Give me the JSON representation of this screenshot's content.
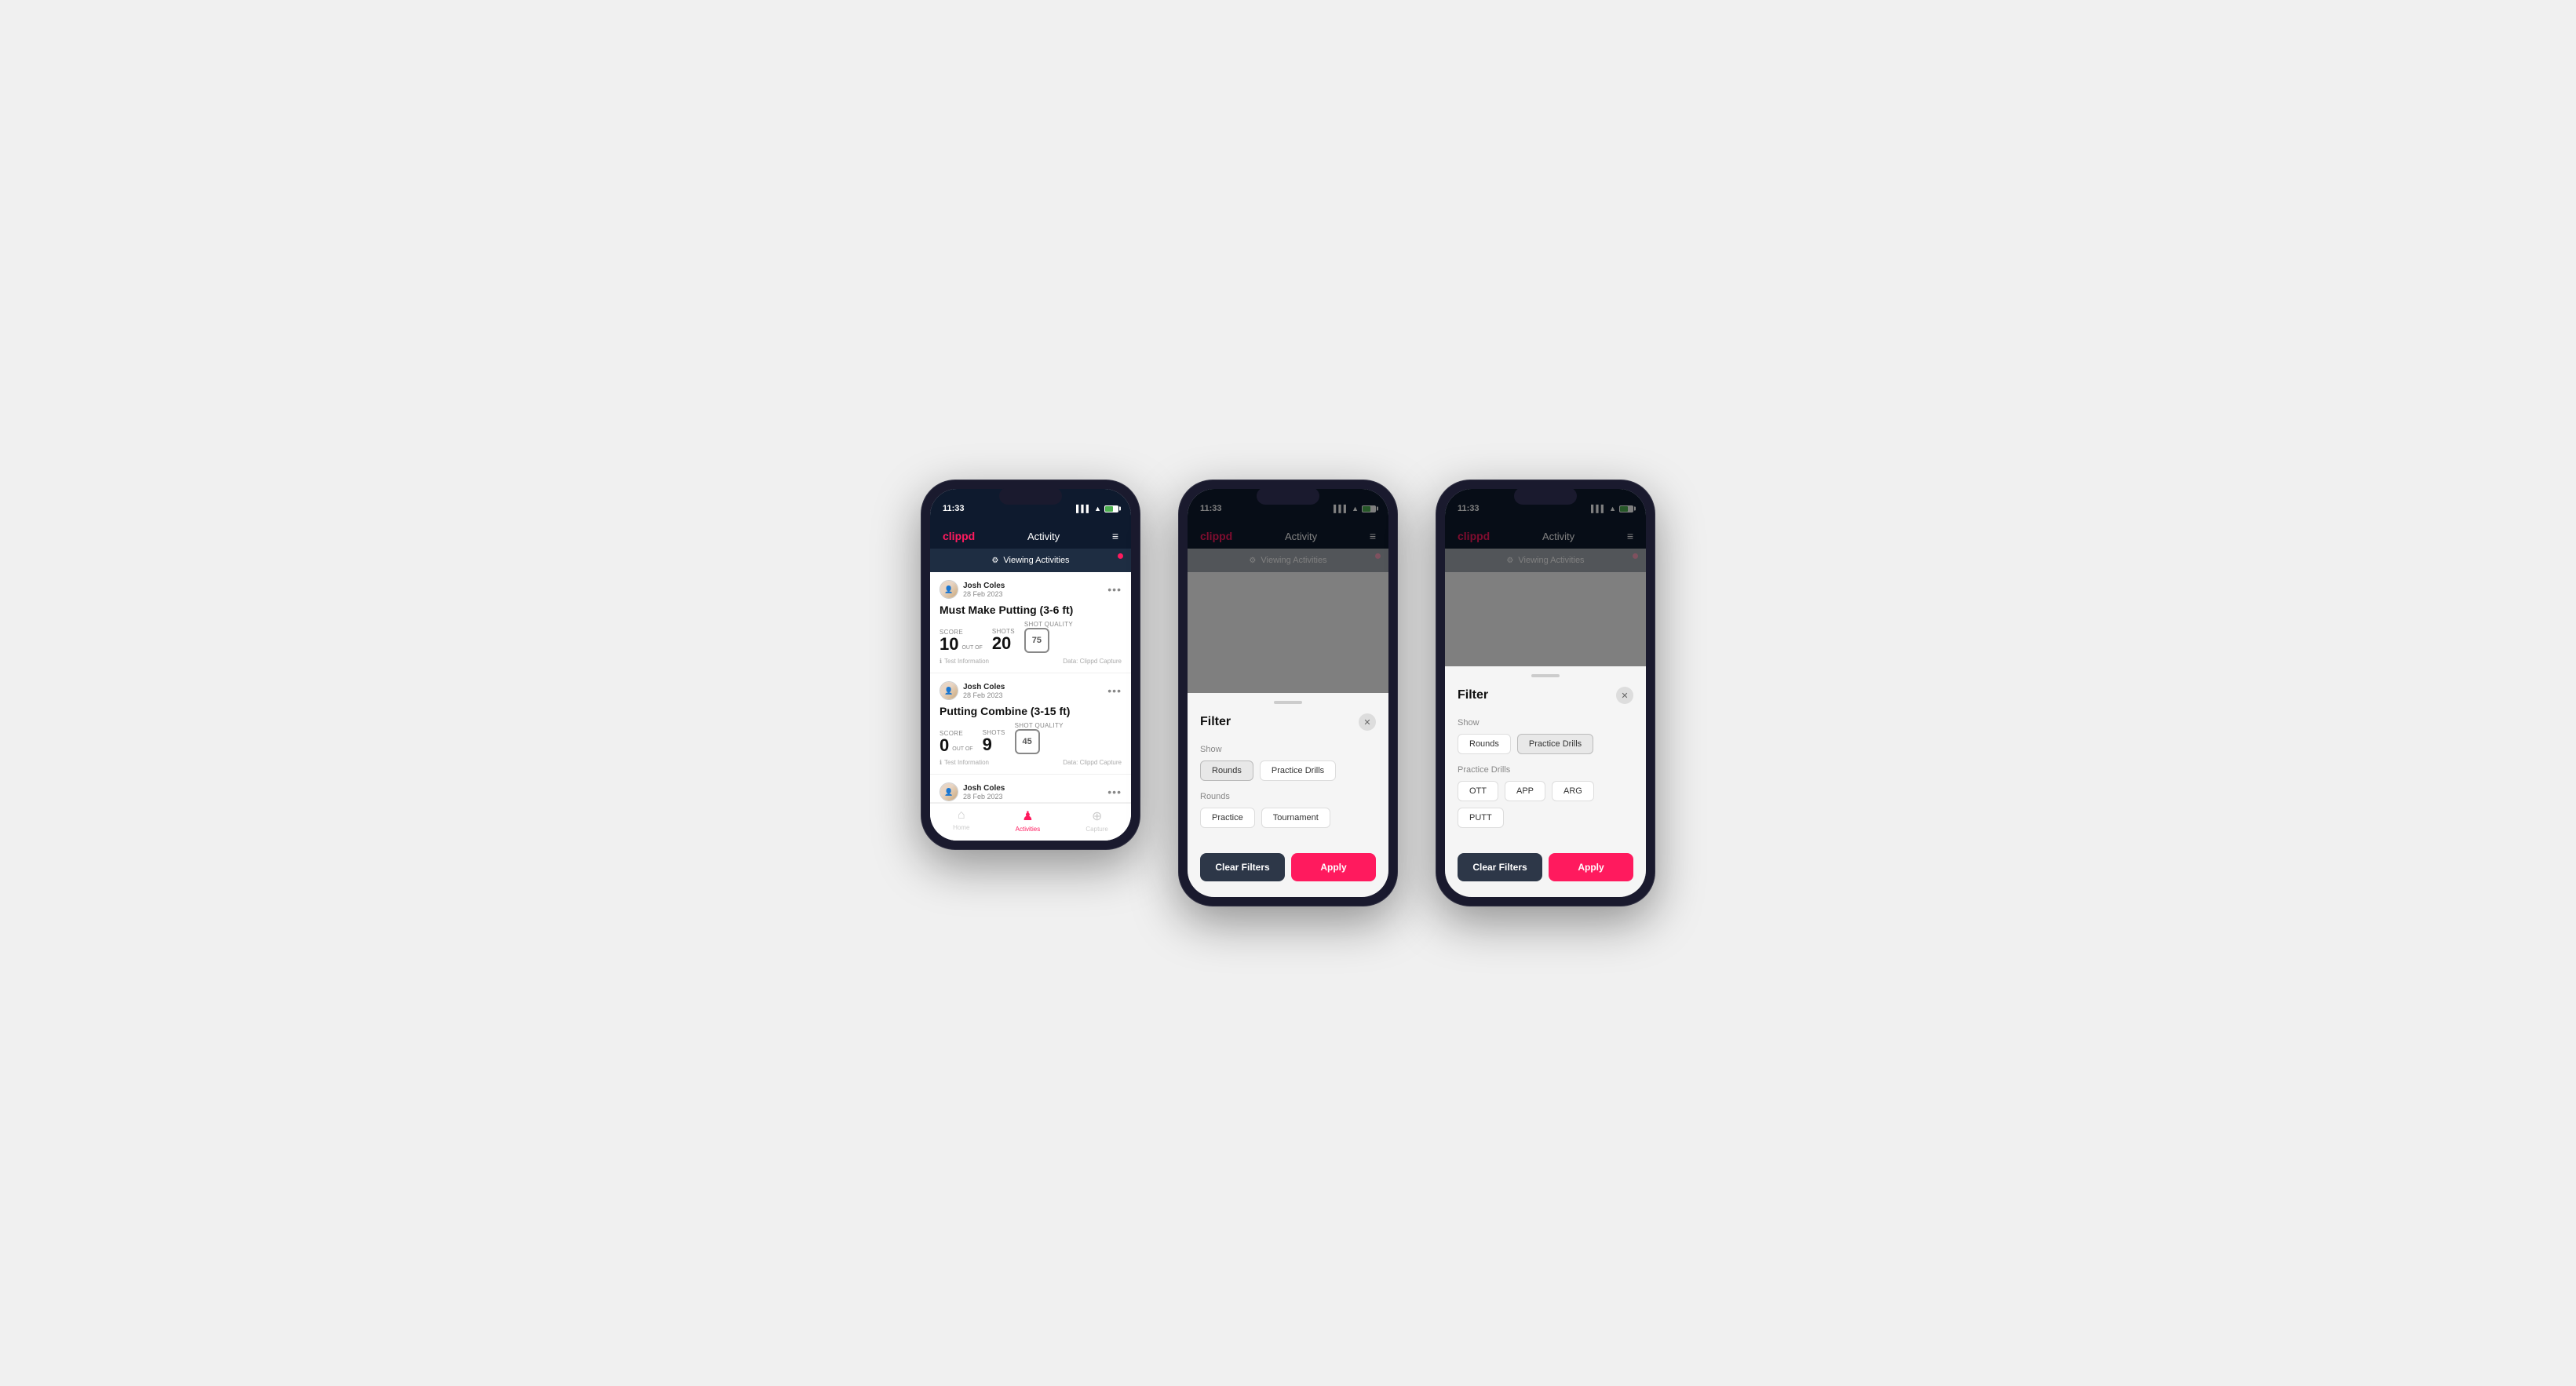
{
  "phones": [
    {
      "id": "phone1",
      "statusBar": {
        "time": "11:33",
        "batteryLevel": 60
      },
      "header": {
        "logo": "clippd",
        "title": "Activity"
      },
      "banner": {
        "text": "Viewing Activities",
        "hasDot": true
      },
      "cards": [
        {
          "user": "Josh Coles",
          "date": "28 Feb 2023",
          "title": "Must Make Putting (3-6 ft)",
          "scoreLabel": "Score",
          "scoreValue": "10",
          "outOf": "OUT OF",
          "shotsLabel": "Shots",
          "shotsValue": "20",
          "sqLabel": "Shot Quality",
          "sqValue": "75",
          "infoText": "Test Information",
          "dataSource": "Data: Clippd Capture"
        },
        {
          "user": "Josh Coles",
          "date": "28 Feb 2023",
          "title": "Putting Combine (3-15 ft)",
          "scoreLabel": "Score",
          "scoreValue": "0",
          "outOf": "OUT OF",
          "shotsLabel": "Shots",
          "shotsValue": "9",
          "sqLabel": "Shot Quality",
          "sqValue": "45",
          "infoText": "Test Information",
          "dataSource": "Data: Clippd Capture"
        },
        {
          "user": "Josh Coles",
          "date": "28 Feb 2023",
          "title": "",
          "partial": true
        }
      ],
      "bottomNav": [
        {
          "label": "Home",
          "icon": "⌂",
          "active": false
        },
        {
          "label": "Activities",
          "icon": "♟",
          "active": true
        },
        {
          "label": "Capture",
          "icon": "+",
          "active": false
        }
      ]
    },
    {
      "id": "phone2",
      "statusBar": {
        "time": "11:33",
        "batteryLevel": 60
      },
      "header": {
        "logo": "clippd",
        "title": "Activity"
      },
      "banner": {
        "text": "Viewing Activities",
        "hasDot": true
      },
      "hasFilter": true,
      "filter": {
        "title": "Filter",
        "showLabel": "Show",
        "showOptions": [
          {
            "label": "Rounds",
            "active": true
          },
          {
            "label": "Practice Drills",
            "active": false
          }
        ],
        "roundsLabel": "Rounds",
        "roundsOptions": [
          {
            "label": "Practice",
            "active": false
          },
          {
            "label": "Tournament",
            "active": false
          }
        ],
        "clearLabel": "Clear Filters",
        "applyLabel": "Apply"
      }
    },
    {
      "id": "phone3",
      "statusBar": {
        "time": "11:33",
        "batteryLevel": 60
      },
      "header": {
        "logo": "clippd",
        "title": "Activity"
      },
      "banner": {
        "text": "Viewing Activities",
        "hasDot": true
      },
      "hasFilter": true,
      "filter": {
        "title": "Filter",
        "showLabel": "Show",
        "showOptions": [
          {
            "label": "Rounds",
            "active": false
          },
          {
            "label": "Practice Drills",
            "active": true
          }
        ],
        "drillsLabel": "Practice Drills",
        "drillsOptions": [
          {
            "label": "OTT",
            "active": false
          },
          {
            "label": "APP",
            "active": false
          },
          {
            "label": "ARG",
            "active": false
          },
          {
            "label": "PUTT",
            "active": false
          }
        ],
        "clearLabel": "Clear Filters",
        "applyLabel": "Apply"
      }
    }
  ]
}
